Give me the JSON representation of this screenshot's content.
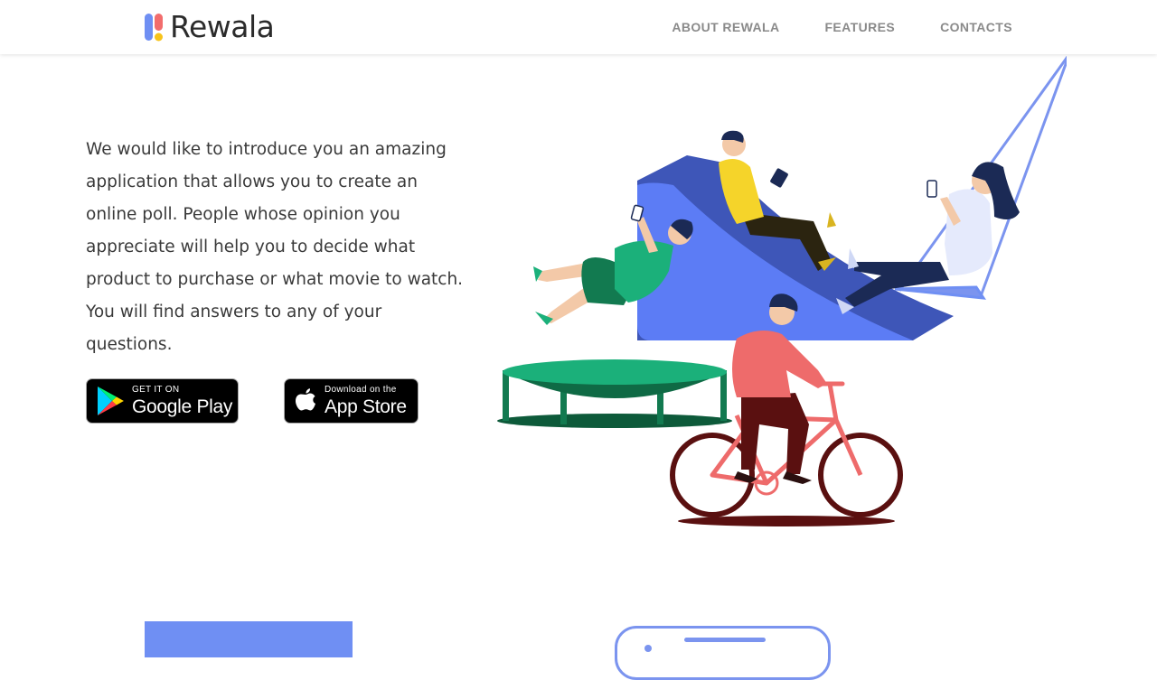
{
  "header": {
    "logo_text": "Rewala",
    "nav": [
      {
        "label": "ABOUT REWALA"
      },
      {
        "label": "FEATURES"
      },
      {
        "label": "CONTACTS"
      }
    ]
  },
  "intro": {
    "text": "We would like to introduce you an amazing application that allows you to create an online poll. People whose opinion you appreciate will help you to decide what product to purchase or what movie to watch. You will find answers to any of your questions."
  },
  "badges": {
    "google": {
      "small": "GET IT ON",
      "big": "Google Play"
    },
    "apple": {
      "small": "Download on the",
      "big": "App Store"
    }
  },
  "colors": {
    "brand_blue": "#6f8ff3",
    "slide_blue": "#5c7cf5",
    "trampoline_green": "#1bb07a",
    "bike_red": "#ee6b6b",
    "nav_gray": "#8a8a8a"
  }
}
